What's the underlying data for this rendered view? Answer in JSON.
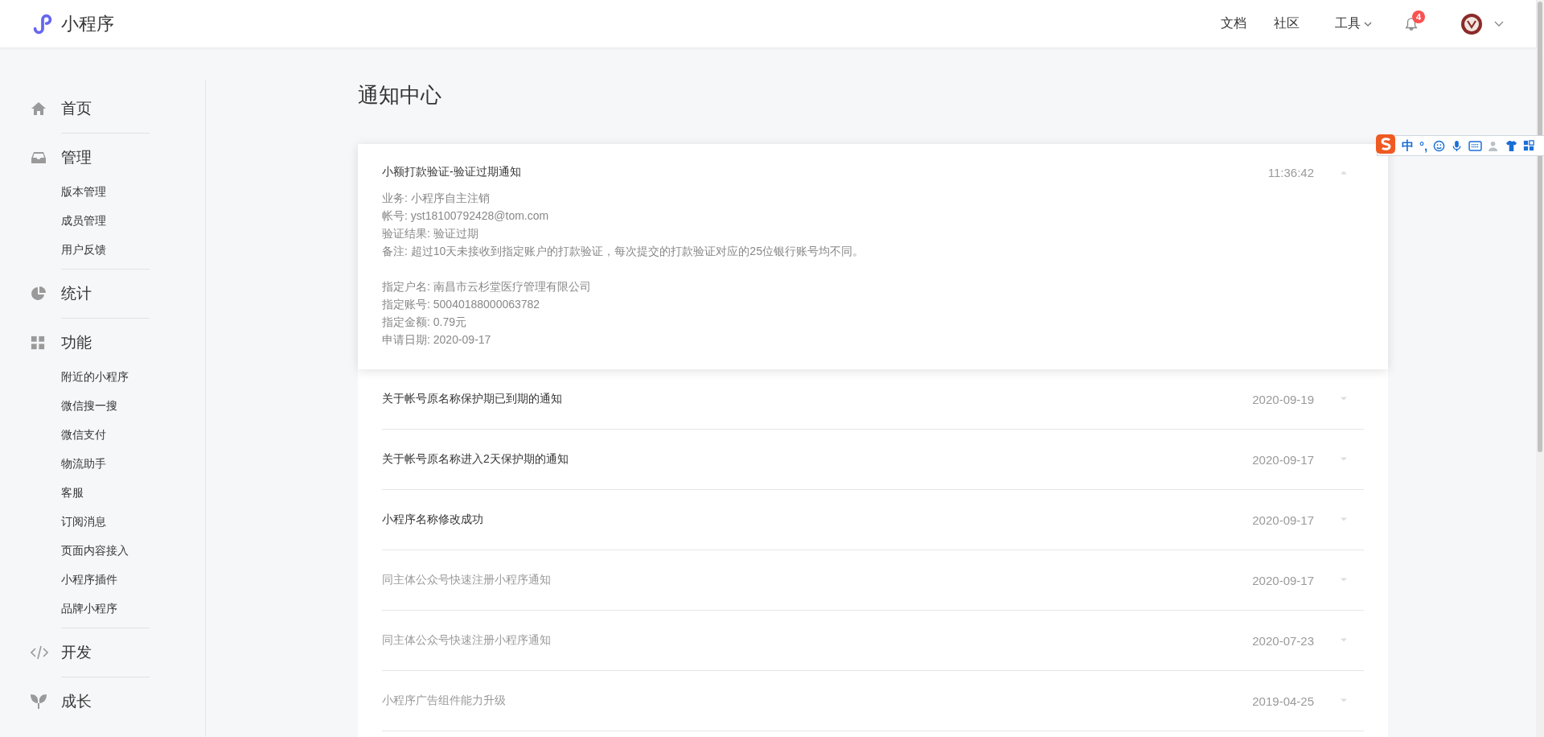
{
  "brand": {
    "name": "小程序"
  },
  "top_nav": [
    {
      "label": "文档",
      "dropdown": false
    },
    {
      "label": "社区",
      "dropdown": false
    },
    {
      "label": "工具",
      "dropdown": true
    }
  ],
  "notifications_badge": "4",
  "ime_toolbar": {
    "mode": "中",
    "punctuation": "°,"
  },
  "sidebar": [
    {
      "label": "首页"
    },
    {
      "label": "管理",
      "children": [
        {
          "label": "版本管理"
        },
        {
          "label": "成员管理"
        },
        {
          "label": "用户反馈"
        }
      ]
    },
    {
      "label": "统计"
    },
    {
      "label": "功能",
      "children": [
        {
          "label": "附近的小程序"
        },
        {
          "label": "微信搜一搜"
        },
        {
          "label": "微信支付"
        },
        {
          "label": "物流助手"
        },
        {
          "label": "客服"
        },
        {
          "label": "订阅消息"
        },
        {
          "label": "页面内容接入"
        },
        {
          "label": "小程序插件"
        },
        {
          "label": "品牌小程序"
        }
      ]
    },
    {
      "label": "开发"
    },
    {
      "label": "成长"
    }
  ],
  "page_title": "通知中心",
  "notifications": [
    {
      "title": "小额打款验证-验证过期通知",
      "time": "11:36:42",
      "unread": true,
      "expanded": true,
      "details": [
        [
          "业务: 小程序自主注销",
          "帐号: yst18100792428@tom.com",
          "验证结果: 验证过期",
          "备注: 超过10天未接收到指定账户的打款验证，每次提交的打款验证对应的25位银行账号均不同。"
        ],
        [
          "指定户名: 南昌市云杉堂医疗管理有限公司",
          "指定账号: 50040188000063782",
          "指定金额: 0.79元",
          "申请日期: 2020-09-17"
        ]
      ]
    },
    {
      "title": "关于帐号原名称保护期已到期的通知",
      "time": "2020-09-19",
      "unread": true,
      "expanded": false
    },
    {
      "title": "关于帐号原名称进入2天保护期的通知",
      "time": "2020-09-17",
      "unread": true,
      "expanded": false
    },
    {
      "title": "小程序名称修改成功",
      "time": "2020-09-17",
      "unread": true,
      "expanded": false
    },
    {
      "title": "同主体公众号快速注册小程序通知",
      "time": "2020-09-17",
      "unread": false,
      "expanded": false
    },
    {
      "title": "同主体公众号快速注册小程序通知",
      "time": "2020-07-23",
      "unread": false,
      "expanded": false
    },
    {
      "title": "小程序广告组件能力升级",
      "time": "2019-04-25",
      "unread": false,
      "expanded": false
    }
  ]
}
